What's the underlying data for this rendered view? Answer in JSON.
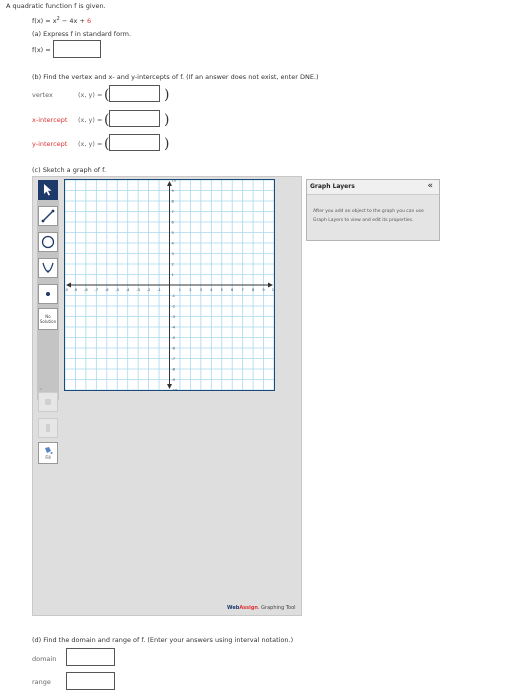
{
  "intro": "A quadratic function f is given.",
  "function_lhs": "f(x) = x",
  "function_exp": "2",
  "function_mid": " − 4x + ",
  "function_const": "6",
  "part_a": {
    "prompt": "(a) Express f in standard form.",
    "label": "f(x) ="
  },
  "part_b": {
    "prompt": "(b) Find the vertex and x- and y-intercepts of f. (If an answer does not exist, enter DNE.)",
    "rows": [
      {
        "label": "vertex",
        "coord": "(x, y) ="
      },
      {
        "label": "x-intercept",
        "coord": "(x, y) ="
      },
      {
        "label": "y-intercept",
        "coord": "(x, y) ="
      }
    ],
    "paren_open": "(",
    "paren_close": ")"
  },
  "part_c": {
    "prompt": "(c) Sketch a graph of f."
  },
  "tools": {
    "no_solution": "No Solution",
    "fill": "Fill",
    "disabled_label": "≡"
  },
  "graph": {
    "x_tick_labels": [
      "-10",
      "-9",
      "-8",
      "-7",
      "-6",
      "-5",
      "-4",
      "-3",
      "-2",
      "-1",
      "1",
      "2",
      "3",
      "4",
      "5",
      "6",
      "7",
      "8",
      "9",
      "10"
    ],
    "y_tick_labels": [
      "10",
      "9",
      "8",
      "7",
      "6",
      "5",
      "4",
      "3",
      "2",
      "1",
      "-1",
      "-2",
      "-3",
      "-4",
      "-5",
      "-6",
      "-7",
      "-8",
      "-9",
      "-10"
    ],
    "xlim": [
      -10,
      10
    ],
    "ylim": [
      -10,
      10
    ],
    "grid_color": "#a8d8ee",
    "axis_color": "#333333"
  },
  "layers": {
    "title": "Graph Layers",
    "collapse": "«",
    "description": "After you add an object to the graph you can use Graph Layers to view and edit its properties."
  },
  "branding": {
    "brand": "WebAssign",
    "brand_accent": "Assign",
    "suffix": ". Graphing Tool"
  },
  "part_d": {
    "prompt": "(d) Find the domain and range of f. (Enter your answers using interval notation.)",
    "domain_label": "domain",
    "range_label": "range"
  }
}
